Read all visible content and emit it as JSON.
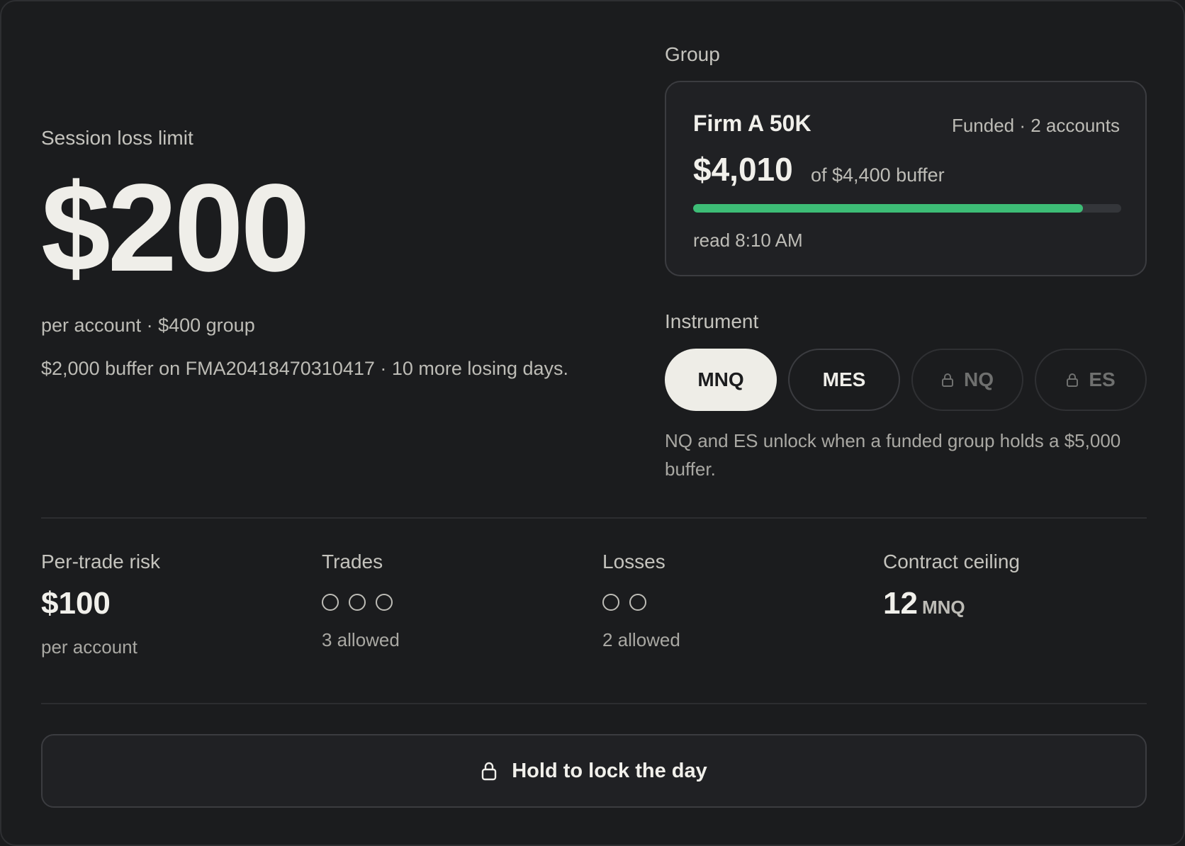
{
  "session": {
    "label": "Session loss limit",
    "amount": "$200",
    "sub1": "per account · $400 group",
    "sub2": "$2,000 buffer on FMA20418470310417 · 10 more losing days."
  },
  "group": {
    "label": "Group",
    "name": "Firm A 50K",
    "meta": "Funded · 2 accounts",
    "amount": "$4,010",
    "of_text": "of $4,400 buffer",
    "progress": 0.911,
    "progress_color": "#3dbd76",
    "read_time": "read 8:10 AM"
  },
  "instrument": {
    "label": "Instrument",
    "chips": [
      {
        "label": "MNQ",
        "state": "active"
      },
      {
        "label": "MES",
        "state": "available"
      },
      {
        "label": "NQ",
        "state": "locked",
        "icon": "lock-icon"
      },
      {
        "label": "ES",
        "state": "locked",
        "icon": "lock-icon"
      }
    ],
    "note": "NQ and ES unlock when a funded group holds a $5,000 buffer."
  },
  "stats": {
    "per_trade": {
      "title": "Per-trade risk",
      "value": "$100",
      "sub": "per account"
    },
    "trades": {
      "title": "Trades",
      "dots": 3,
      "sub": "3 allowed"
    },
    "losses": {
      "title": "Losses",
      "dots": 2,
      "sub": "2 allowed"
    },
    "ceiling": {
      "title": "Contract ceiling",
      "value": "12",
      "unit": "MNQ"
    }
  },
  "action": {
    "label": "Hold to lock the day",
    "icon": "lock-icon"
  }
}
